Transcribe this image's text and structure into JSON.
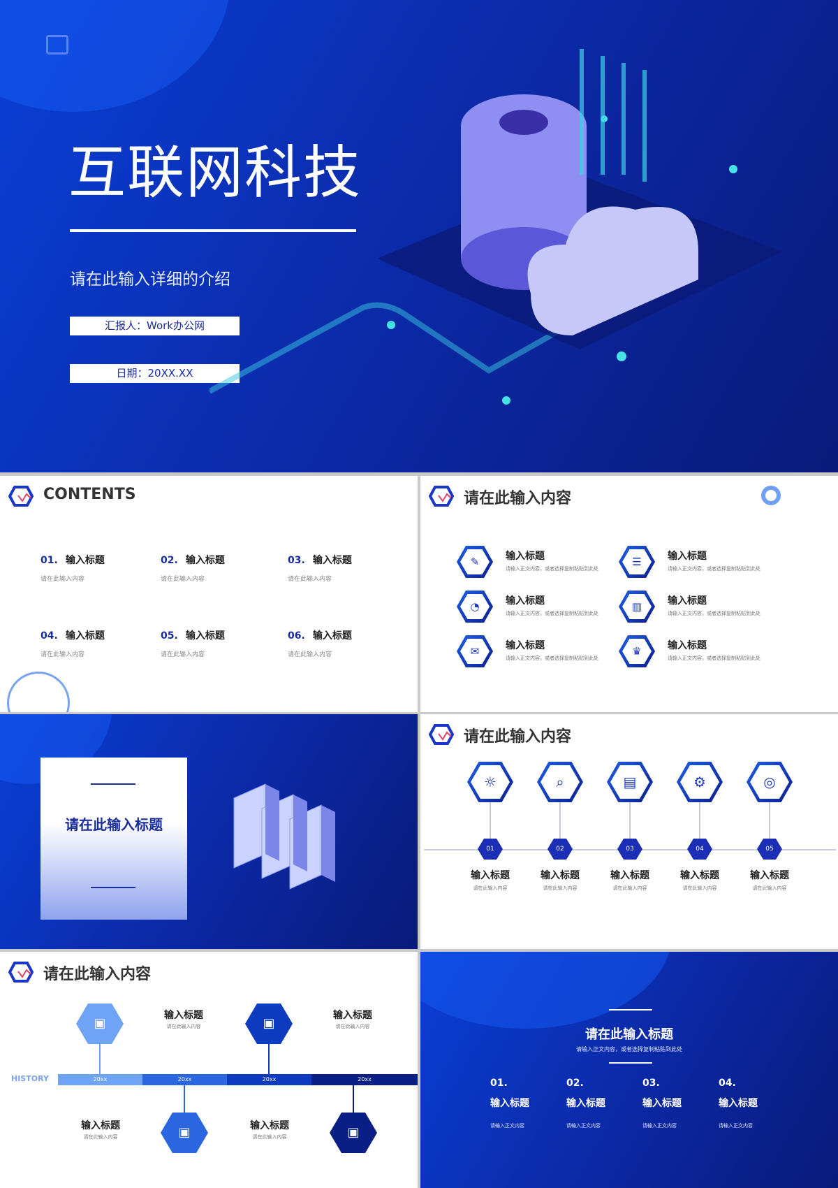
{
  "cover": {
    "title": "互联网科技",
    "subtitle": "请在此输入详细的介绍",
    "reporter": "汇报人：Work办公网",
    "date": "日期：20XX.XX"
  },
  "contents": {
    "title": "CONTENTS",
    "items": [
      {
        "num": "01.",
        "title": "输入标题",
        "desc": "请在此输入内容"
      },
      {
        "num": "02.",
        "title": "输入标题",
        "desc": "请在此输入内容"
      },
      {
        "num": "03.",
        "title": "输入标题",
        "desc": "请在此输入内容"
      },
      {
        "num": "04.",
        "title": "输入标题",
        "desc": "请在此输入内容"
      },
      {
        "num": "05.",
        "title": "输入标题",
        "desc": "请在此输入内容"
      },
      {
        "num": "06.",
        "title": "输入标题",
        "desc": "请在此输入内容"
      }
    ]
  },
  "features": {
    "title": "请在此输入内容",
    "items": [
      {
        "icon": "document-edit-icon",
        "title": "输入标题",
        "desc": "请输入正文内容，或者选择复制粘贴到此处"
      },
      {
        "icon": "clipboard-list-icon",
        "title": "输入标题",
        "desc": "请输入正文内容，或者选择复制粘贴到此处"
      },
      {
        "icon": "pie-chart-icon",
        "title": "输入标题",
        "desc": "请输入正文内容，或者选择复制粘贴到此处"
      },
      {
        "icon": "bar-chart-icon",
        "title": "输入标题",
        "desc": "请输入正文内容，或者选择复制粘贴到此处"
      },
      {
        "icon": "chat-icon",
        "title": "输入标题",
        "desc": "请输入正文内容，或者选择复制粘贴到此处"
      },
      {
        "icon": "trophy-icon",
        "title": "输入标题",
        "desc": "请输入正文内容，或者选择复制粘贴到此处"
      }
    ]
  },
  "section": {
    "title": "请在此输入标题"
  },
  "process": {
    "title": "请在此输入内容",
    "items": [
      {
        "num": "01",
        "icon": "lightbulb-icon",
        "title": "输入标题",
        "desc": "请在此输入内容"
      },
      {
        "num": "02",
        "icon": "search-icon",
        "title": "输入标题",
        "desc": "请在此输入内容"
      },
      {
        "num": "03",
        "icon": "document-icon",
        "title": "输入标题",
        "desc": "请在此输入内容"
      },
      {
        "num": "04",
        "icon": "gear-target-icon",
        "title": "输入标题",
        "desc": "请在此输入内容"
      },
      {
        "num": "05",
        "icon": "target-icon",
        "title": "输入标题",
        "desc": "请在此输入内容"
      }
    ]
  },
  "history": {
    "title": "请在此输入内容",
    "label": "HISTORY",
    "years": [
      "20xx",
      "20xx",
      "20xx",
      "20xx"
    ],
    "colors": [
      "#6fa3f5",
      "#2a66e0",
      "#0d3bc0",
      "#0a1f86"
    ],
    "items": [
      {
        "title": "输入标题",
        "desc": "请在此输入内容"
      },
      {
        "title": "输入标题",
        "desc": "请在此输入内容"
      },
      {
        "title": "输入标题",
        "desc": "请在此输入内容"
      },
      {
        "title": "输入标题",
        "desc": "请在此输入内容"
      }
    ]
  },
  "ending": {
    "title": "请在此输入标题",
    "subtitle": "请输入正文内容，或者选择复制粘贴到此处",
    "items": [
      {
        "num": "01.",
        "title": "输入标题",
        "desc": "请输入正文内容"
      },
      {
        "num": "02.",
        "title": "输入标题",
        "desc": "请输入正文内容"
      },
      {
        "num": "03.",
        "title": "输入标题",
        "desc": "请输入正文内容"
      },
      {
        "num": "04.",
        "title": "输入标题",
        "desc": "请输入正文内容"
      }
    ]
  }
}
